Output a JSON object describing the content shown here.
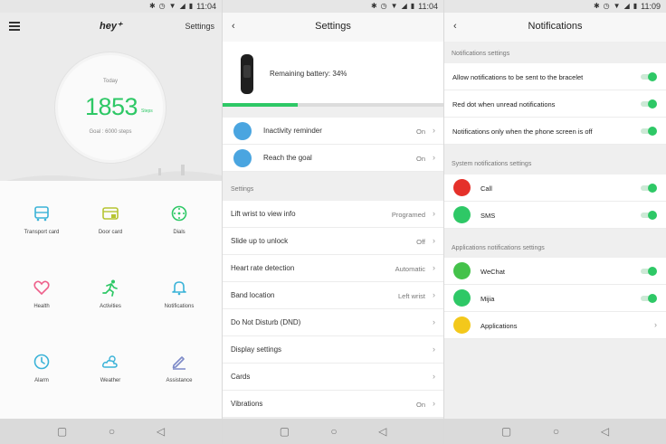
{
  "status_bar": {
    "left_time": "11:04",
    "middle_time": "11:04",
    "right_time": "11:09"
  },
  "home": {
    "logo": "hey⁺",
    "settings_label": "Settings",
    "today_label": "Today",
    "steps": "1853",
    "steps_unit": "Steps",
    "goal": "Goal : 6000 steps",
    "tiles": [
      {
        "label": "Transport card",
        "icon": "bus-icon"
      },
      {
        "label": "Door card",
        "icon": "door-card-icon"
      },
      {
        "label": "Dials",
        "icon": "dial-icon"
      },
      {
        "label": "Health",
        "icon": "heart-icon"
      },
      {
        "label": "Activities",
        "icon": "runner-icon"
      },
      {
        "label": "Notifications",
        "icon": "bell-icon"
      },
      {
        "label": "Alarm",
        "icon": "clock-icon"
      },
      {
        "label": "Weather",
        "icon": "cloud-sun-icon"
      },
      {
        "label": "Assistance",
        "icon": "pencil-icon"
      }
    ]
  },
  "settings": {
    "title": "Settings",
    "battery_text": "Remaining battery: 34%",
    "battery_level": 0.34,
    "quick": [
      {
        "label": "Inactivity reminder",
        "value": "On"
      },
      {
        "label": "Reach the goal",
        "value": "On"
      }
    ],
    "section_label": "Settings",
    "items": [
      {
        "label": "Lift wrist to view info",
        "value": "Programed"
      },
      {
        "label": "Slide up to unlock",
        "value": "Off"
      },
      {
        "label": "Heart rate detection",
        "value": "Automatic"
      },
      {
        "label": "Band location",
        "value": "Left wrist"
      },
      {
        "label": "Do Not Disturb (DND)",
        "value": ""
      },
      {
        "label": "Display settings",
        "value": ""
      },
      {
        "label": "Cards",
        "value": ""
      },
      {
        "label": "Vibrations",
        "value": "On"
      }
    ]
  },
  "notifications": {
    "title": "Notifications",
    "section1": "Notifications settings",
    "general": [
      {
        "label": "Allow notifications to be sent to the bracelet"
      },
      {
        "label": "Red dot when unread notifications"
      },
      {
        "label": "Notifications only when the phone screen is off"
      }
    ],
    "section2": "System notifications settings",
    "system": [
      {
        "label": "Call"
      },
      {
        "label": "SMS"
      }
    ],
    "section3": "Applications notifications settings",
    "apps": [
      {
        "label": "WeChat"
      },
      {
        "label": "Mijia"
      },
      {
        "label": "Applications"
      }
    ]
  },
  "colors": {
    "accent": "#2ec866",
    "call_red": "#e5312a",
    "sms_green": "#2ec866",
    "wechat_green": "#44c24a",
    "apps_yellow": "#f3c81b"
  }
}
